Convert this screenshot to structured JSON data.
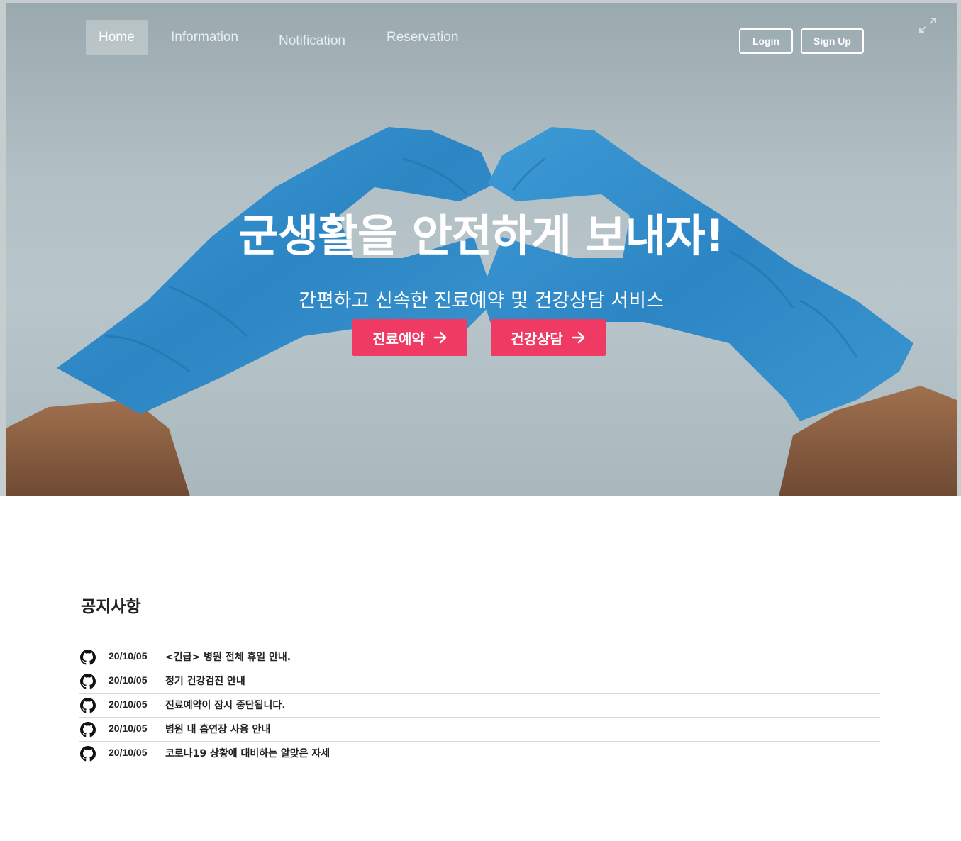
{
  "nav": {
    "items": [
      {
        "label": "Home"
      },
      {
        "label": "Information"
      },
      {
        "label": "Notification"
      },
      {
        "label": "Reservation"
      }
    ],
    "active": "Home",
    "login_label": "Login",
    "signup_label": "Sign Up"
  },
  "hero": {
    "title": "군생활을 안전하게 보내자!",
    "subtitle": "간편하고 신속한 진료예약 및 건강상담 서비스",
    "buttons": [
      {
        "label": "진료예약",
        "icon": "arrow-right-icon"
      },
      {
        "label": "건강상담",
        "icon": "arrow-right-icon"
      }
    ],
    "accent_color": "#ef3b63"
  },
  "notices": {
    "heading": "공지사항",
    "icon": "github-icon",
    "items": [
      {
        "date": "20/10/05",
        "title": "<긴급> 병원 전체 휴일 안내."
      },
      {
        "date": "20/10/05",
        "title": "정기 건강검진 안내"
      },
      {
        "date": "20/10/05",
        "title": "진료예약이 잠시 중단됩니다."
      },
      {
        "date": "20/10/05",
        "title": "병원 내 흡연장 사용 안내"
      },
      {
        "date": "20/10/05",
        "title": "코로나19 상황에 대비하는 알맞은 자세"
      }
    ]
  }
}
